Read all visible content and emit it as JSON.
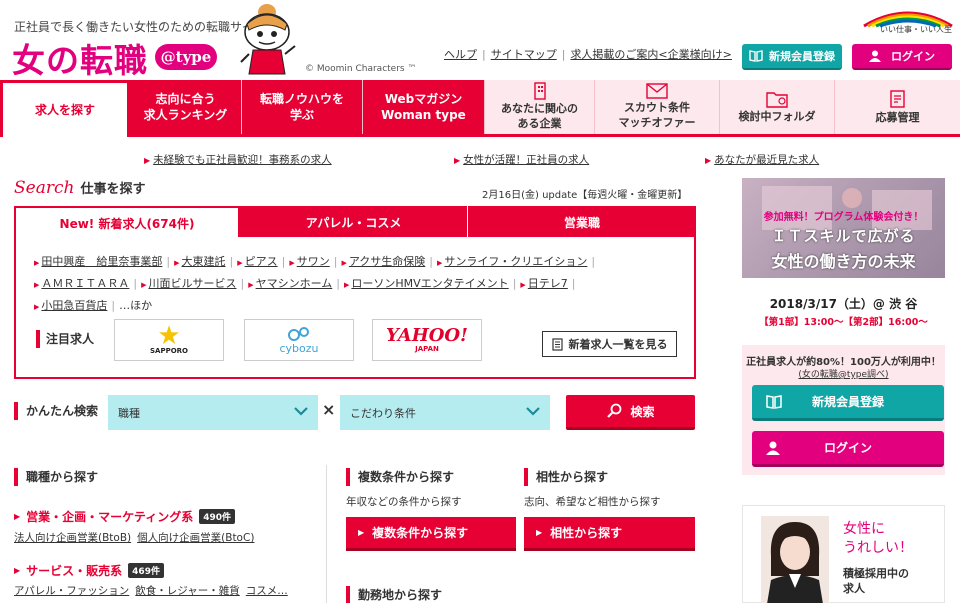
{
  "header": {
    "tagline": "正社員で長く働きたい女性のための転職サイト",
    "logo": "女の転職",
    "logo_badge": "@type",
    "copyright": "© Moomin Characters ™",
    "util_links": [
      "ヘルプ",
      "サイトマップ",
      "求人掲載のご案内<企業様向け>"
    ],
    "corp_logo_text": "いい仕事・いい人生",
    "register_label": "新規会員登録",
    "login_label": "ログイン"
  },
  "nav": {
    "items": [
      {
        "label": "求人を探す"
      },
      {
        "label": "志向に合う\n求人ランキング"
      },
      {
        "label": "転職ノウハウを\n学ぶ"
      },
      {
        "label": "Webマガジン\nWoman type"
      },
      {
        "label": "あなたに関心の\nある企業"
      },
      {
        "label": "スカウト条件\nマッチオファー"
      },
      {
        "label": "検討中フォルダ"
      },
      {
        "label": "応募管理"
      }
    ]
  },
  "quick_links": [
    "未経験でも正社員歓迎！事務系の求人",
    "女性が活躍！正社員の求人",
    "あなたが最近見た求人"
  ],
  "search": {
    "script_title": "Search",
    "title": "仕事を探す",
    "update": "2月16日(金) update【毎週火曜・金曜更新】",
    "tabs": [
      "New! 新着求人(674件)",
      "アパレル・コスメ",
      "営業職"
    ],
    "companies_line1": [
      "田中興産　給里奈事業部",
      "大東建託",
      "ピアス",
      "サワン",
      "アクサ生命保険",
      "サンライフ・クリエイション"
    ],
    "companies_line2": [
      "ＡＭＲＩＴＡＲＡ",
      "川面ビルサービス",
      "ヤマシンホーム",
      "ローソンHMVエンタテイメント",
      "日テレ7"
    ],
    "companies_line3": [
      "小田急百貨店"
    ],
    "more": "…ほか",
    "featured_label": "注目求人",
    "sponsors": {
      "sapporo": "SAPPORO",
      "cybozu": "cybozu",
      "yahoo": "YAHOO!",
      "yahoo_sub": "JAPAN"
    },
    "newlist_button": "新着求人一覧を見る"
  },
  "simple_search": {
    "label": "かんたん検索",
    "select1": "職種",
    "times": "×",
    "select2": "こだわり条件",
    "button": "検索"
  },
  "browse": {
    "by_job_label": "職種から探す",
    "categories": [
      {
        "title": "営業・企画・マーケティング系",
        "count": "490件",
        "subs": [
          "法人向け企画営業(BtoB)",
          "個人向け企画営業(BtoC)"
        ]
      },
      {
        "title": "サービス・販売系",
        "count": "469件",
        "subs": [
          "アパレル・ファッション",
          "飲食・レジャー・雑貨",
          "コスメ…"
        ]
      }
    ],
    "multi_label": "複数条件から探す",
    "multi_desc": "年収などの条件から探す",
    "multi_button": "複数条件から探す",
    "compat_label": "相性から探す",
    "compat_desc": "志向、希望など相性から探す",
    "compat_button": "相性から探す",
    "location_label": "勤務地から探す"
  },
  "sidebar": {
    "banner_top": "参加無料！プログラム体験会付き！",
    "banner_head1": "ＩＴスキルで広がる",
    "banner_head2": "女性の働き方の未来",
    "banner_date": "2018/3/17（土）@ 渋 谷",
    "banner_parts": "【第1部】13:00〜【第2部】16:00〜",
    "box_t1": "正社員求人が約80%！100万人が利用中！",
    "box_t2": "(女の転職@type調べ)",
    "register_label": "新規会員登録",
    "login_label": "ログイン",
    "photo_t1": "女性に\nうれしい！",
    "photo_t2": "積極採用中の\n求人"
  },
  "colors": {
    "primary_red": "#e60033",
    "brand_pink": "#e3007f",
    "teal": "#10a6a6"
  }
}
